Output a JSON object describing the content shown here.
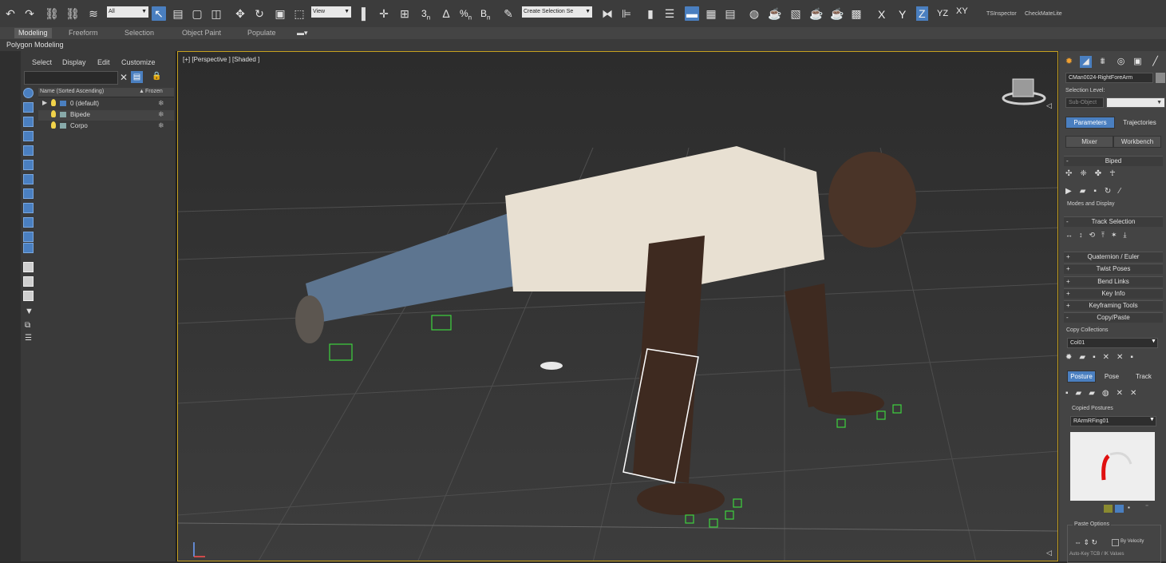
{
  "toolbar": {
    "selection_filter": "All",
    "ref_coord": "View",
    "named_selection": "Create Selection Se",
    "axis_x": "X",
    "axis_y": "Y",
    "axis_z": "Z",
    "axis_yz": "YZ",
    "axis_xy": "XY",
    "plugin_1": "TSInspector",
    "plugin_2": "CheckMateLite",
    "snap_3": "3",
    "snap_n": "n",
    "snap_pct": "%",
    "snap_b": "B"
  },
  "ribbon": {
    "tabs": [
      "Modeling",
      "Freeform",
      "Selection",
      "Object Paint",
      "Populate"
    ],
    "active_sub": "Polygon Modeling"
  },
  "scene_explorer": {
    "menus": [
      "Select",
      "Display",
      "Edit",
      "Customize"
    ],
    "col_name": "Name (Sorted Ascending)",
    "col_frozen": "Frozen",
    "rows": [
      "0 (default)",
      "Bipede",
      "Corpo"
    ]
  },
  "viewport": {
    "label": "[+] [Perspective ] [Shaded ]"
  },
  "command_panel": {
    "object_name": "CMan0024-RightForeArm",
    "selection_level": "Selection Level:",
    "sub_object": "Sub-Object",
    "tab_parameters": "Parameters",
    "tab_trajectories": "Trajectories",
    "btn_mixer": "Mixer",
    "btn_workbench": "Workbench",
    "rollout_biped": "Biped",
    "modes_display": "Modes and Display",
    "rollout_track": "Track Selection",
    "rollouts": [
      "Quaternion / Euler",
      "Twist Poses",
      "Bend Links",
      "Key Info",
      "Keyframing Tools",
      "Copy/Paste"
    ],
    "copy_collections": "Copy Collections",
    "collection": "Col01",
    "tab_posture": "Posture",
    "tab_pose": "Pose",
    "tab_track": "Track",
    "copied_postures": "Copied Postures",
    "posture_value": "RArmRFing01",
    "paste_options": "Paste Options",
    "by_velocity": "By Velocity",
    "auto_key": "Auto-Key TCB / IK Values"
  },
  "colors": {
    "accent": "#4a7fc0",
    "viewport_border": "#c7a11f",
    "rig_green": "#3ed33e"
  }
}
